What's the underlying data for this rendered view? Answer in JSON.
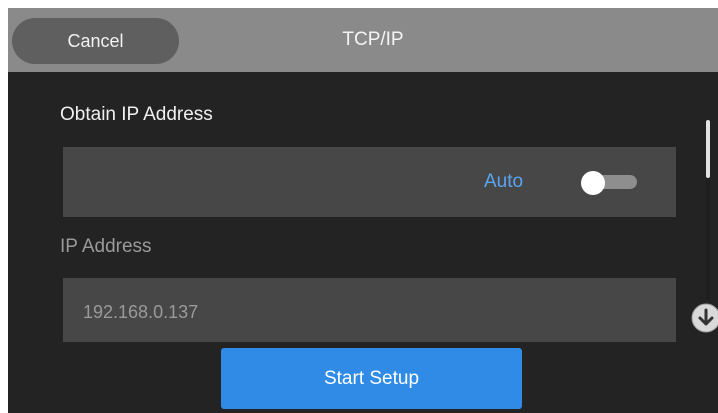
{
  "header": {
    "cancel_label": "Cancel",
    "title": "TCP/IP"
  },
  "obtain_ip": {
    "label": "Obtain IP Address",
    "value": "Auto",
    "toggle_on": false
  },
  "ip_address": {
    "label": "IP Address",
    "value": "192.168.0.137"
  },
  "footer": {
    "start_label": "Start Setup"
  },
  "icons": {
    "scroll_down": "arrow-down-circle-icon",
    "toggle": "toggle-switch-icon"
  },
  "colors": {
    "header_bg": "#8a8a8a",
    "screen_bg": "#232323",
    "row_bg": "#474747",
    "accent_blue": "#2f8be6",
    "auto_text": "#5aa5f2"
  }
}
